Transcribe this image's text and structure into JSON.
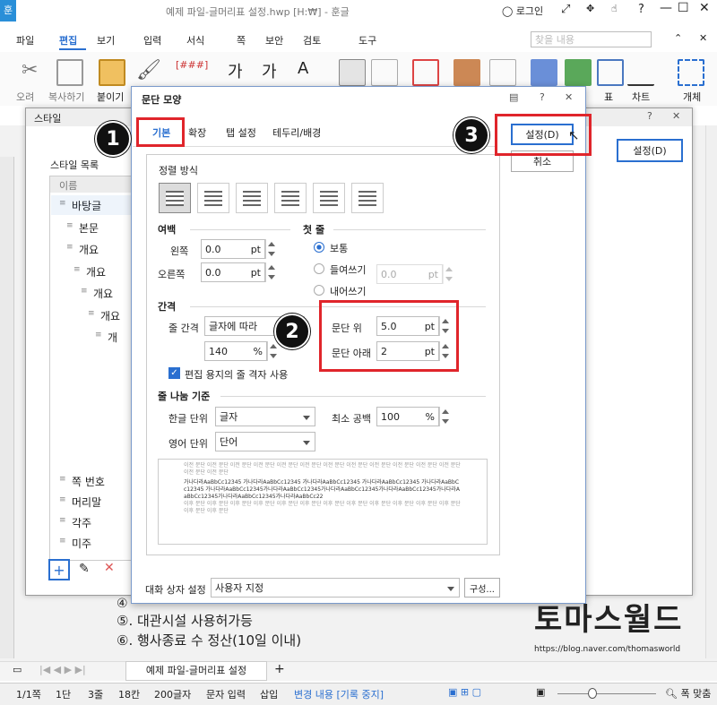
{
  "window": {
    "title": "예제 파일-글머리표 설정.hwp [H:₩] - 훈글",
    "login": "로그인",
    "help": "?"
  },
  "menu": [
    "파일",
    "편집",
    "보기",
    "입력",
    "서식",
    "쪽",
    "보안",
    "검토",
    "도구"
  ],
  "search_placeholder": "찾을 내용",
  "toolbar": {
    "cut": "오려",
    "copy": "복사하기",
    "paste": "붙이기",
    "table": "표",
    "chart": "차트",
    "obj": "개체"
  },
  "style_dialog": {
    "title": "스타일",
    "list_label": "스타일 목록",
    "col_name": "이름",
    "items": [
      "바탕글",
      "본문",
      "개요",
      "개요",
      "개요",
      "개요",
      "개",
      "",
      "",
      "",
      "",
      "",
      "",
      "",
      "쪽 번호",
      "머리말",
      "각주",
      "미주"
    ],
    "setting": "설정(D)"
  },
  "para_dialog": {
    "title": "문단 모양",
    "tabs": [
      "기본",
      "확장",
      "탭 설정",
      "테두리/배경"
    ],
    "ok": "설정(D)",
    "cancel": "취소",
    "align_label": "정렬 방식",
    "margin_label": "여백",
    "left_label": "왼쪽",
    "left_val": "0.0",
    "right_label": "오른쪽",
    "right_val": "0.0",
    "unit_pt": "pt",
    "first_label": "첫 줄",
    "first_opts": [
      "보통",
      "들여쓰기",
      "내어쓰기"
    ],
    "first_val": "0.0",
    "spacing_label": "간격",
    "line_label": "줄 간격",
    "line_mode": "글자에 따라",
    "line_val": "140",
    "unit_pct": "%",
    "above_label": "문단 위",
    "above_val": "5.0",
    "below_label": "문단 아래",
    "below_val": "2",
    "grid_check": "편집 용지의 줄 격자 사용",
    "break_label": "줄 나눔 기준",
    "kor_label": "한글 단위",
    "kor_val": "글자",
    "eng_label": "영어 단위",
    "eng_val": "단어",
    "minspace_label": "최소 공백",
    "minspace_val": "100",
    "preview_prev": "이전 문단 이전 문단 이전 문단 이전 문단 이전 문단 이전 문단 이전 문단 이전 문단 이전 문단 이전 문단 이전 문단 이전 문단 이전 문단 이전 문단",
    "preview_cur": "가나다라AaBbCc12345 가나다라AaBbCc12345 가나다라AaBbCc12345 가나다라AaBbCc12345 가나다라AaBbCc12345 가나다라AaBbCc12345가나다라AaBbCc12345가나다라AaBbCc12345가나다라AaBbCc12345가나다라AaBbCc12345가나다라AaBbCc12345가나다라AaBbCc22",
    "preview_next": "이후 문단 이후 문단 이후 문단 이후 문단 이후 문단 이후 문단 이후 문단 이후 문단 이후 문단 이후 문단 이후 문단 이후 문단 이후 문단 이후 문단",
    "dlg_setting_label": "대화 상자 설정",
    "dlg_setting_val": "사용자 지정",
    "config_btn": "구성..."
  },
  "doc": {
    "line4": "④",
    "line5": "⑤. 대관시설 사용허가등",
    "line6": "⑥. 행사종료 수 정산(10일 이내)"
  },
  "tab_name": "예제 파일-글머리표 설정",
  "watermark": {
    "title": "토마스월드",
    "url": "https://blog.naver.com/thomasworld"
  },
  "status": [
    "1/1쪽",
    "1단",
    "3줄",
    "18칸",
    "200글자",
    "문자 입력",
    "삽입",
    "변경 내용 [기록 중지]"
  ],
  "zoom_label": "폭 맞춤",
  "markers": [
    "1",
    "2",
    "3"
  ]
}
